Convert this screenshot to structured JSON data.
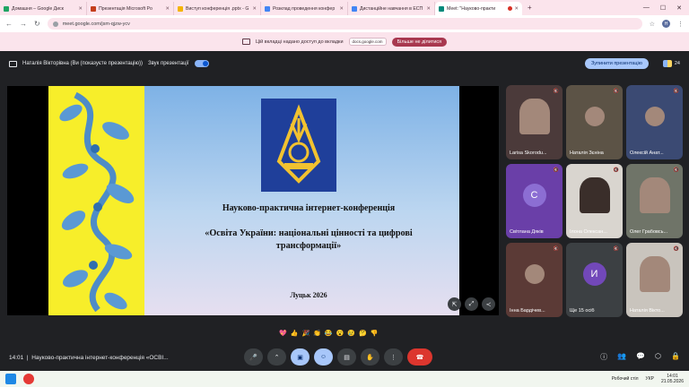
{
  "browser": {
    "tabs": [
      {
        "label": "Домашня – Google Диск",
        "color": "#1fa463"
      },
      {
        "label": "Презентація Microsoft Po",
        "color": "#c43e1c"
      },
      {
        "label": "Виступ конференція .pptx - G",
        "color": "#f4b400"
      },
      {
        "label": "Розклад проведення конфер",
        "color": "#4285f4"
      },
      {
        "label": "Дистанційне навчання в ЕСП",
        "color": "#4285f4"
      },
      {
        "label": "Meet: \"Науково-практи",
        "color": "#00897b",
        "active": true
      }
    ],
    "new_tab": "+",
    "url": "meet.google.com/jsm-qjzw-ycv"
  },
  "share_banner": {
    "text": "Цій вкладці надано доступ до вкладки",
    "host": "docs.google.com",
    "stop_label": "Більше не ділитися"
  },
  "presenter_bar": {
    "presenter": "Наталія Вікторівна (Ви (показуєте презентацію))",
    "sound_label": "Звук презентації",
    "stop_label": "Зупинити презентацію",
    "participants_count": "24"
  },
  "slide": {
    "line1": "Науково-практична інтернет-конференція",
    "line2": "«Освіта України: національні цінності та цифрові трансформації»",
    "line3": "Луцьк 2026"
  },
  "participants": [
    {
      "name": "Larisa Skorodu...",
      "bg": "#4b3a3a",
      "kind": "photo"
    },
    {
      "name": "Наталія Зєніна",
      "bg": "#5c5346",
      "kind": "photo-small"
    },
    {
      "name": "Олексій Анат...",
      "bg": "#3b4a73",
      "kind": "photo-small"
    },
    {
      "name": "Світлана Дяків",
      "bg": "#6a3fa8",
      "kind": "letter",
      "letter": "С"
    },
    {
      "name": "Ілона Олексан...",
      "bg": "#d9d5cf",
      "kind": "photo"
    },
    {
      "name": "Олег Грабовсь...",
      "bg": "#6f7468",
      "kind": "photo"
    },
    {
      "name": "Інна Бардічев...",
      "bg": "#5b3a36",
      "kind": "photo-small"
    },
    {
      "name": "Ще 15 осіб",
      "bg": "#3c4043",
      "kind": "more",
      "letter": "И"
    },
    {
      "name": "Наталія Вікто...",
      "bg": "#c9c4bd",
      "kind": "photo"
    }
  ],
  "bottom": {
    "time": "14:01",
    "meeting": "Науково-практична інтернет-конференція «ОСВІ..."
  },
  "reactions": [
    "💖",
    "👍",
    "🎉",
    "👏",
    "😂",
    "😮",
    "😢",
    "🤔",
    "👎"
  ],
  "taskbar": {
    "workspace": "Робочий стіл",
    "lang": "УКР",
    "clock_time": "14:01",
    "clock_date": "21.05.2026"
  }
}
